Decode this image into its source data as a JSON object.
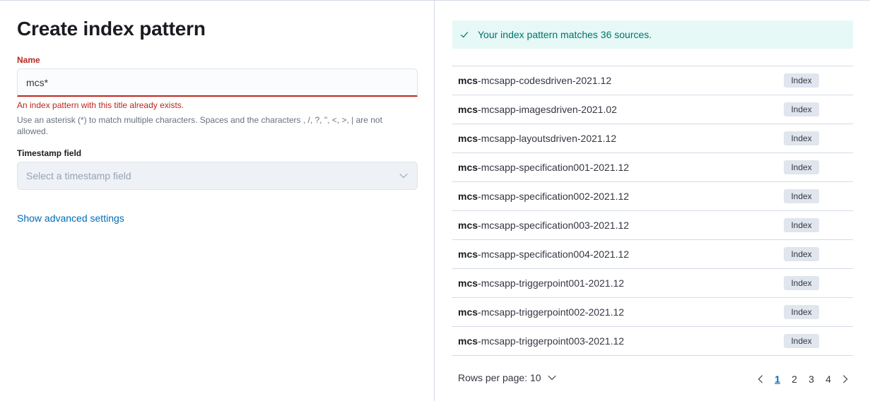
{
  "form": {
    "title": "Create index pattern",
    "name_label": "Name",
    "name_value": "mcs*",
    "error": "An index pattern with this title already exists.",
    "help": "Use an asterisk (*) to match multiple characters. Spaces and the characters , /, ?, \", <, >, | are not allowed.",
    "timestamp_label": "Timestamp field",
    "timestamp_placeholder": "Select a timestamp field",
    "advanced_link": "Show advanced settings"
  },
  "results": {
    "callout": "Your index pattern matches 36 sources.",
    "rows": [
      {
        "prefix": "mcs",
        "rest": "-mcsapp-codesdriven-2021.12",
        "badge": "Index"
      },
      {
        "prefix": "mcs",
        "rest": "-mcsapp-imagesdriven-2021.02",
        "badge": "Index"
      },
      {
        "prefix": "mcs",
        "rest": "-mcsapp-layoutsdriven-2021.12",
        "badge": "Index"
      },
      {
        "prefix": "mcs",
        "rest": "-mcsapp-specification001-2021.12",
        "badge": "Index"
      },
      {
        "prefix": "mcs",
        "rest": "-mcsapp-specification002-2021.12",
        "badge": "Index"
      },
      {
        "prefix": "mcs",
        "rest": "-mcsapp-specification003-2021.12",
        "badge": "Index"
      },
      {
        "prefix": "mcs",
        "rest": "-mcsapp-specification004-2021.12",
        "badge": "Index"
      },
      {
        "prefix": "mcs",
        "rest": "-mcsapp-triggerpoint001-2021.12",
        "badge": "Index"
      },
      {
        "prefix": "mcs",
        "rest": "-mcsapp-triggerpoint002-2021.12",
        "badge": "Index"
      },
      {
        "prefix": "mcs",
        "rest": "-mcsapp-triggerpoint003-2021.12",
        "badge": "Index"
      }
    ],
    "rows_per_page": "Rows per page: 10",
    "pages": [
      "1",
      "2",
      "3",
      "4"
    ],
    "active_page": "1"
  },
  "colors": {
    "error": "#bd271e",
    "link": "#006bb8",
    "success_bg": "#e6f9f7",
    "success_text": "#00726b"
  },
  "icons": {
    "callout": "check-icon",
    "select": "chevron-down-icon",
    "rows_per_page": "chevron-down-icon",
    "prev": "chevron-left-icon",
    "next": "chevron-right-icon"
  }
}
